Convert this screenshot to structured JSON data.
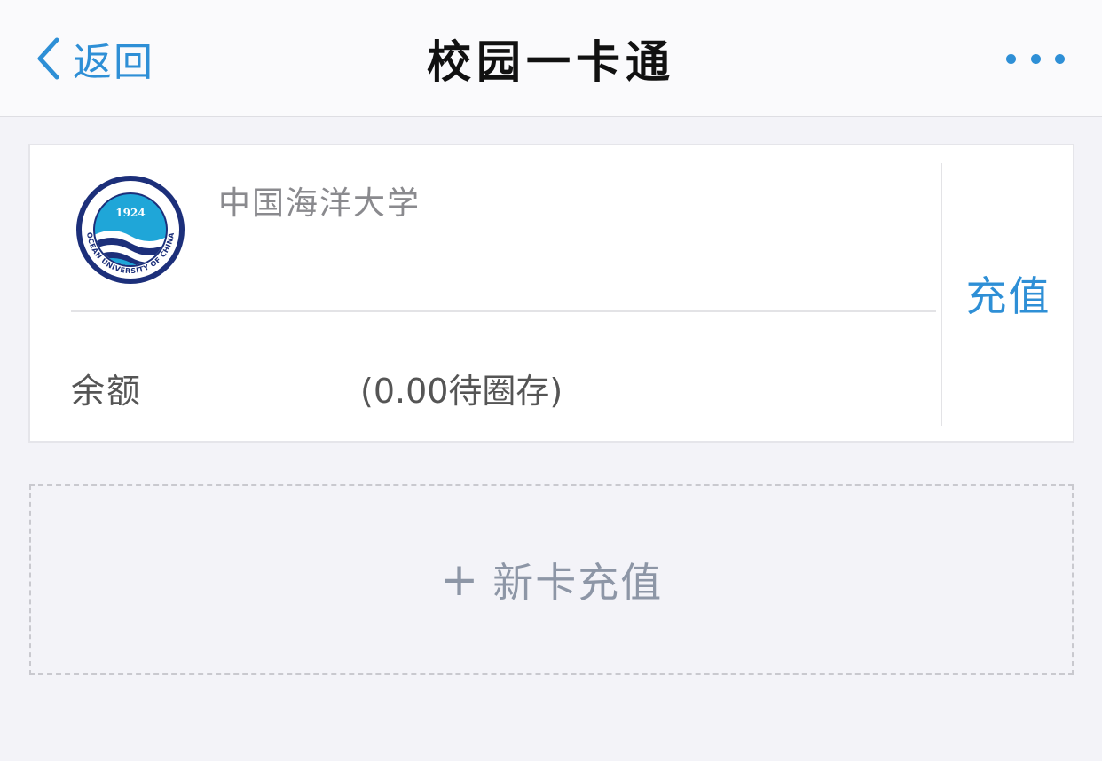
{
  "nav": {
    "back_label": "返回",
    "title": "校园一卡通",
    "more_icon": "more-dots-icon",
    "accent_color": "#2e8fd6"
  },
  "card": {
    "logo": {
      "icon": "university-seal-icon",
      "year": "1924",
      "top_text": "中国海洋大学",
      "ring_text": "OCEAN UNIVERSITY OF CHINA"
    },
    "school_name": "中国海洋大学",
    "balance_label": "余额",
    "balance_value": "(0.00待圈存)",
    "recharge_label": "充值"
  },
  "new_card": {
    "plus_icon": "+",
    "label": "新卡充值"
  }
}
